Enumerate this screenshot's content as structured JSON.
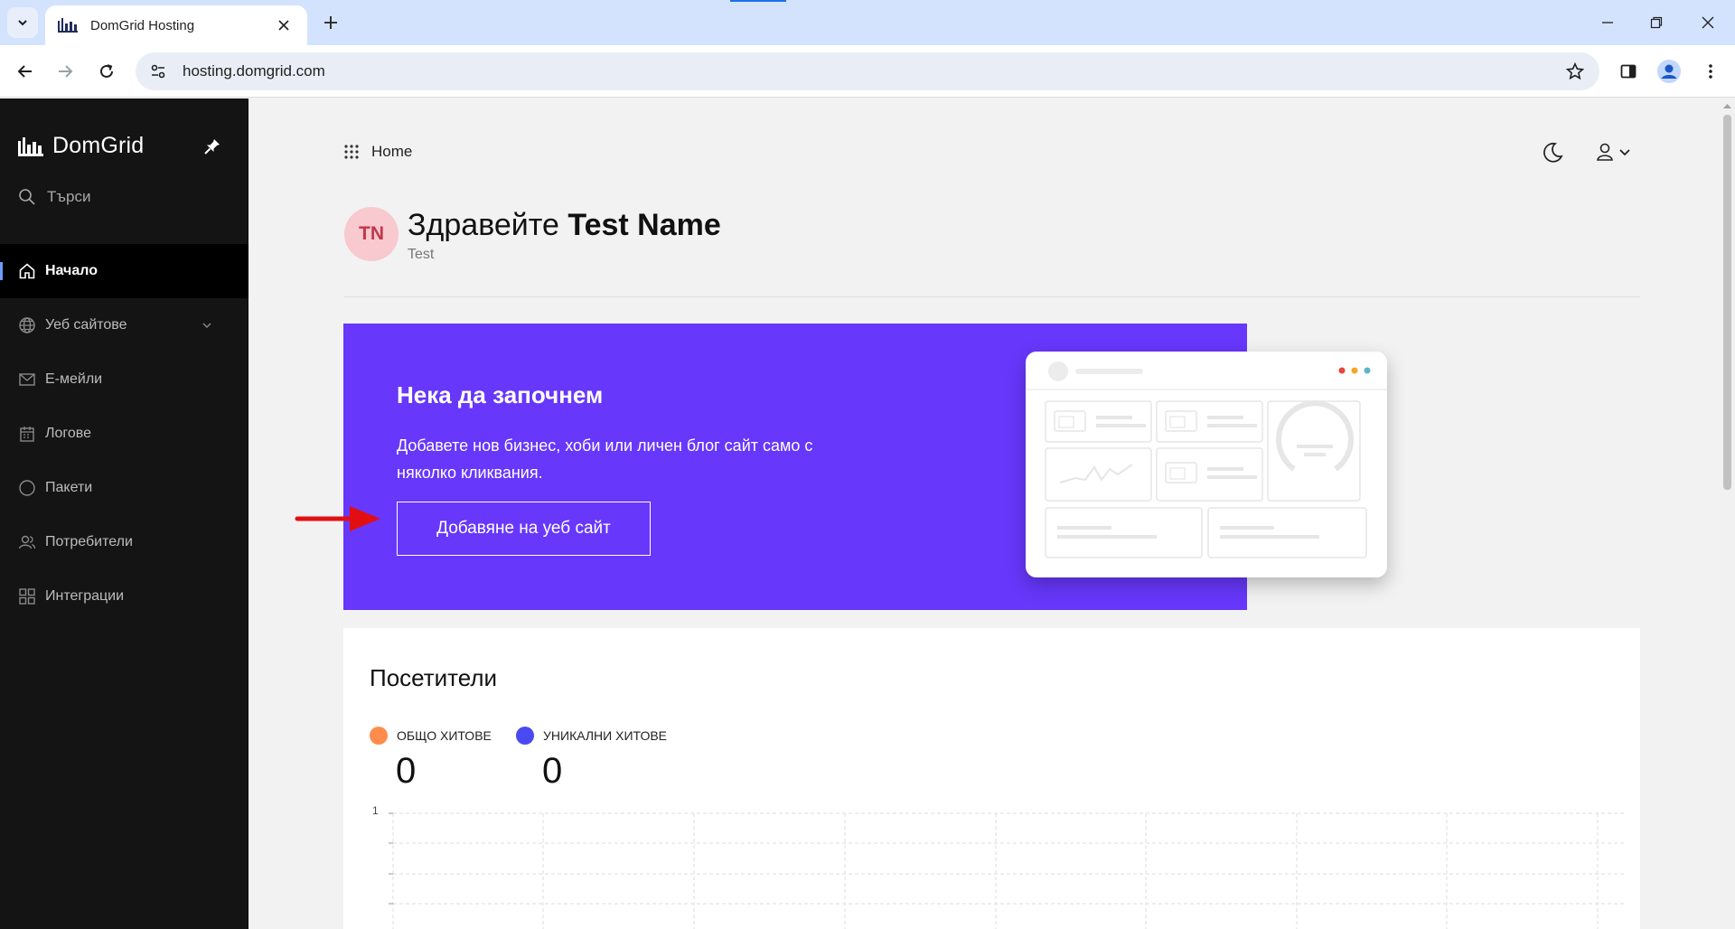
{
  "browser": {
    "tab_title": "DomGrid Hosting",
    "url": "hosting.domgrid.com"
  },
  "sidebar": {
    "brand": "DomGrid",
    "search_placeholder": "Търси",
    "items": [
      {
        "label": "Начало",
        "icon": "home-icon",
        "active": true
      },
      {
        "label": "Уеб сайтове",
        "icon": "globe-icon",
        "active": false,
        "expandable": true
      },
      {
        "label": "Е-мейли",
        "icon": "mail-icon",
        "active": false
      },
      {
        "label": "Логове",
        "icon": "calendar-icon",
        "active": false
      },
      {
        "label": "Пакети",
        "icon": "circle-icon",
        "active": false
      },
      {
        "label": "Потребители",
        "icon": "users-icon",
        "active": false
      },
      {
        "label": "Интеграции",
        "icon": "grid-icon",
        "active": false
      }
    ]
  },
  "header": {
    "breadcrumb": "Home"
  },
  "greeting": {
    "initials": "TN",
    "prefix": "Здравейте",
    "name": "Test Name",
    "subtitle": "Test"
  },
  "hero": {
    "title": "Нека да започнем",
    "text": "Добавете нов бизнес, хоби или личен блог сайт само с няколко кликвания.",
    "button": "Добавяне на уеб сайт",
    "color": "#6737fb"
  },
  "visitors": {
    "title": "Посетители",
    "total_label": "ОБЩО ХИТОВЕ",
    "total_value": "0",
    "total_color": "#ff8c4a",
    "unique_label": "УНИКАЛНИ ХИТОВЕ",
    "unique_value": "0",
    "unique_color": "#4a4af2",
    "y_tick_top": "1"
  }
}
